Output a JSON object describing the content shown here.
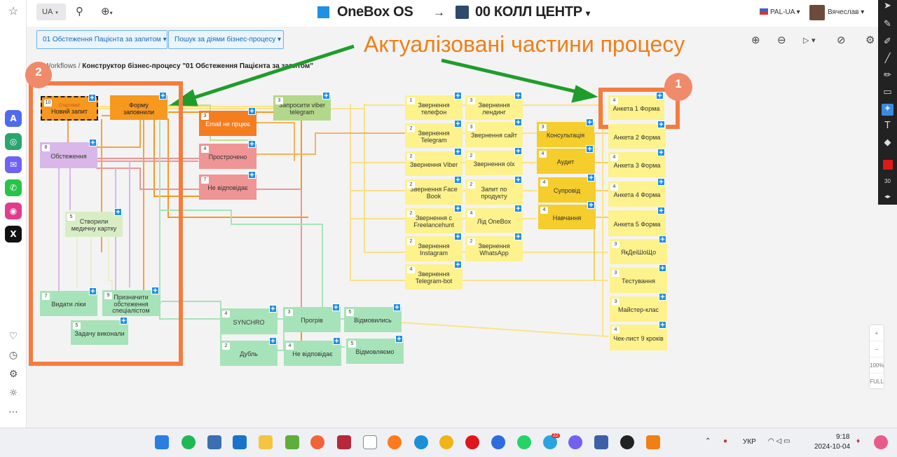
{
  "app": {
    "brand": "OneBox OS",
    "arrow": "→",
    "workspace": "00 КОЛЛ ЦЕНТР",
    "workspace_caret": "▾"
  },
  "topbar": {
    "lang": "UA",
    "lang_caret": "▾",
    "search_icon": "search-icon",
    "add_icon": "plus-circle-icon",
    "add_caret": "▾",
    "org": "PAL-UA",
    "org_caret": "▾",
    "user": "Вячеслав",
    "user_caret": "▾"
  },
  "toolbar": {
    "dropdown1": "01 Обстеження Пацієнта за запитом ▾",
    "dropdown2": "Пошук за діями бізнес-процесу ▾",
    "zoom_in": "⊕",
    "zoom_out": "⊖",
    "play": "▷ ▾",
    "export": "⊘",
    "settings": "⚙"
  },
  "breadcrumb": {
    "root": "Workflows",
    "sep": "/",
    "current": "Конструктор бізнес-процесу \"01 Обстеження Пацієнта за запитом\""
  },
  "annotation": {
    "text": "Актуалізовані частини процесу",
    "badge1": "1",
    "badge2": "2"
  },
  "nodes": [
    {
      "id": "n1",
      "num": "10",
      "label": "Новий запит",
      "sub": "Стартовий"
    },
    {
      "id": "n2",
      "num": "",
      "label": "Форму заповнили"
    },
    {
      "id": "n3",
      "num": "3",
      "label": "Email не прцює"
    },
    {
      "id": "n4",
      "num": "3",
      "label": "Запросити viber telegram"
    },
    {
      "id": "n5",
      "num": "8",
      "label": "Обстеження"
    },
    {
      "id": "n6",
      "num": "4",
      "label": "Прострочено"
    },
    {
      "id": "n7",
      "num": "7",
      "label": "Не відповідає"
    },
    {
      "id": "n8",
      "num": "5",
      "label": "Створили медичну картку"
    },
    {
      "id": "n9",
      "num": "7",
      "label": "Видати ліки"
    },
    {
      "id": "n10",
      "num": "9",
      "label": "Призначити обстеження спеціалістом"
    },
    {
      "id": "n11",
      "num": "5",
      "label": "Задачу виконали"
    },
    {
      "id": "n12",
      "num": "4",
      "label": "SYNCHRO"
    },
    {
      "id": "n13",
      "num": "2",
      "label": "Дубль"
    },
    {
      "id": "n14",
      "num": "3",
      "label": "Прогрів"
    },
    {
      "id": "n15",
      "num": "4",
      "label": "Не відповідає"
    },
    {
      "id": "n16",
      "num": "5",
      "label": "Відмовились"
    },
    {
      "id": "n17",
      "num": "5",
      "label": "Відмовляємо"
    },
    {
      "id": "n18",
      "num": "1",
      "label": "Звернення телефон"
    },
    {
      "id": "n19",
      "num": "2",
      "label": "Звернення Telegram"
    },
    {
      "id": "n20",
      "num": "2",
      "label": "Звернення Viber"
    },
    {
      "id": "n21",
      "num": "2",
      "label": "Звернення Face Book"
    },
    {
      "id": "n22",
      "num": "2",
      "label": "Звернення с Freelancehunt"
    },
    {
      "id": "n23",
      "num": "2",
      "label": "Звернення Instagram"
    },
    {
      "id": "n24",
      "num": "4",
      "label": "Звернення Telegram-bot"
    },
    {
      "id": "n25",
      "num": "3",
      "label": "Звернення лендинг"
    },
    {
      "id": "n26",
      "num": "3",
      "label": "Звернення сайт"
    },
    {
      "id": "n27",
      "num": "2",
      "label": "Звернення olx"
    },
    {
      "id": "n28",
      "num": "2",
      "label": "Запит по продукту"
    },
    {
      "id": "n29",
      "num": "4",
      "label": "Лід OneBox"
    },
    {
      "id": "n30",
      "num": "2",
      "label": "Звернення WhatsApp"
    },
    {
      "id": "n31",
      "num": "3",
      "label": "Консультація"
    },
    {
      "id": "n32",
      "num": "4",
      "label": "Аудит"
    },
    {
      "id": "n33",
      "num": "4",
      "label": "Супровід"
    },
    {
      "id": "n34",
      "num": "4",
      "label": "Навчання"
    },
    {
      "id": "n35",
      "num": "4",
      "label": "Анкета 1 Форма"
    },
    {
      "id": "n36",
      "num": "",
      "label": "Анкета 2 Форма"
    },
    {
      "id": "n37",
      "num": "4",
      "label": "Анкета 3 Форма"
    },
    {
      "id": "n38",
      "num": "4",
      "label": "Анкета 4 Форма"
    },
    {
      "id": "n39",
      "num": "",
      "label": "Анкета 5 Форма"
    },
    {
      "id": "n40",
      "num": "3",
      "label": "ЯкДеіШоЩо"
    },
    {
      "id": "n41",
      "num": "3",
      "label": "Тестування"
    },
    {
      "id": "n42",
      "num": "3",
      "label": "Майстер-клас"
    },
    {
      "id": "n43",
      "num": "4",
      "label": "Чек-лист 9 кроків"
    }
  ],
  "right_toolbar": {
    "brush_size": "30",
    "accent": "#e01818"
  },
  "zoom_control": {
    "plus": "+",
    "minus": "−",
    "level": "100%",
    "fit": "FULL"
  },
  "taskbar": {
    "lang": "УКР",
    "time": "9:18",
    "date": "2024-10-04",
    "badge": "22"
  },
  "colors": {
    "orange": "#f07f14",
    "green_arrow": "#1f9d2a",
    "accent_blue": "#1e8fe6"
  }
}
